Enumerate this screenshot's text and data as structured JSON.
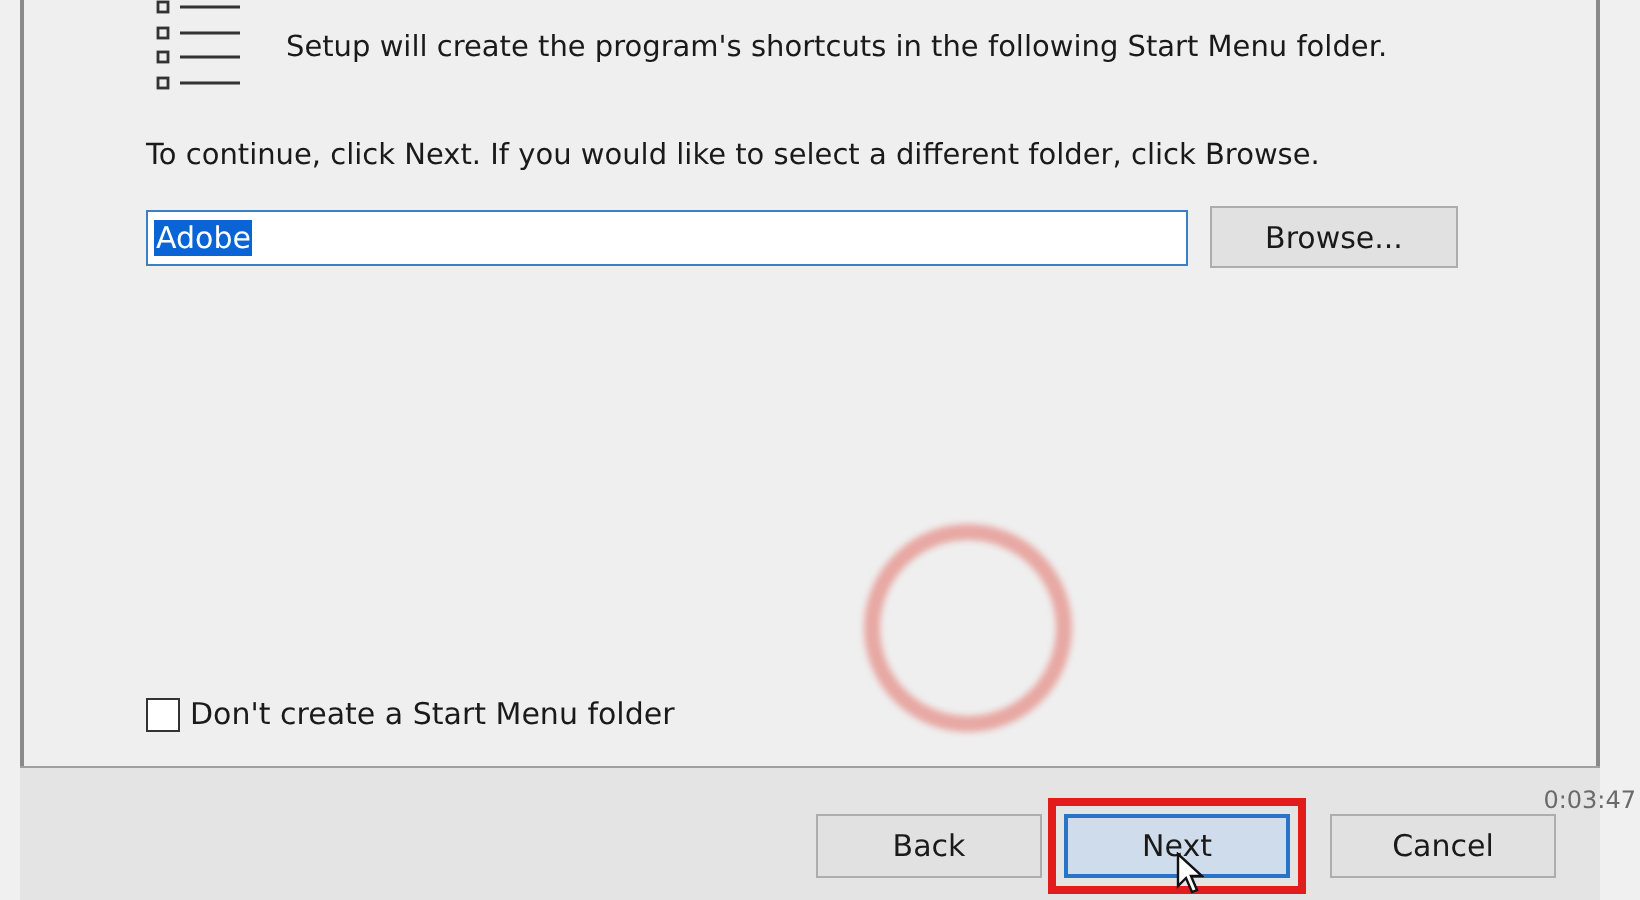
{
  "header": {
    "text": "Setup will create the program's shortcuts in the following Start Menu folder."
  },
  "instruction": "To continue, click Next. If you would like to select a different folder, click Browse.",
  "folder_field": {
    "value": "Adobe",
    "selected": true
  },
  "browse_button": {
    "label": "Browse..."
  },
  "checkbox": {
    "label": "Don't create a Start Menu folder",
    "checked": false
  },
  "buttons": [
    {
      "label": "Back",
      "kind": "normal",
      "highlighted": false
    },
    {
      "label": "Next",
      "kind": "default",
      "highlighted": true
    },
    {
      "label": "Cancel",
      "kind": "normal",
      "highlighted": false
    }
  ],
  "video": {
    "time": "0:03:47"
  }
}
